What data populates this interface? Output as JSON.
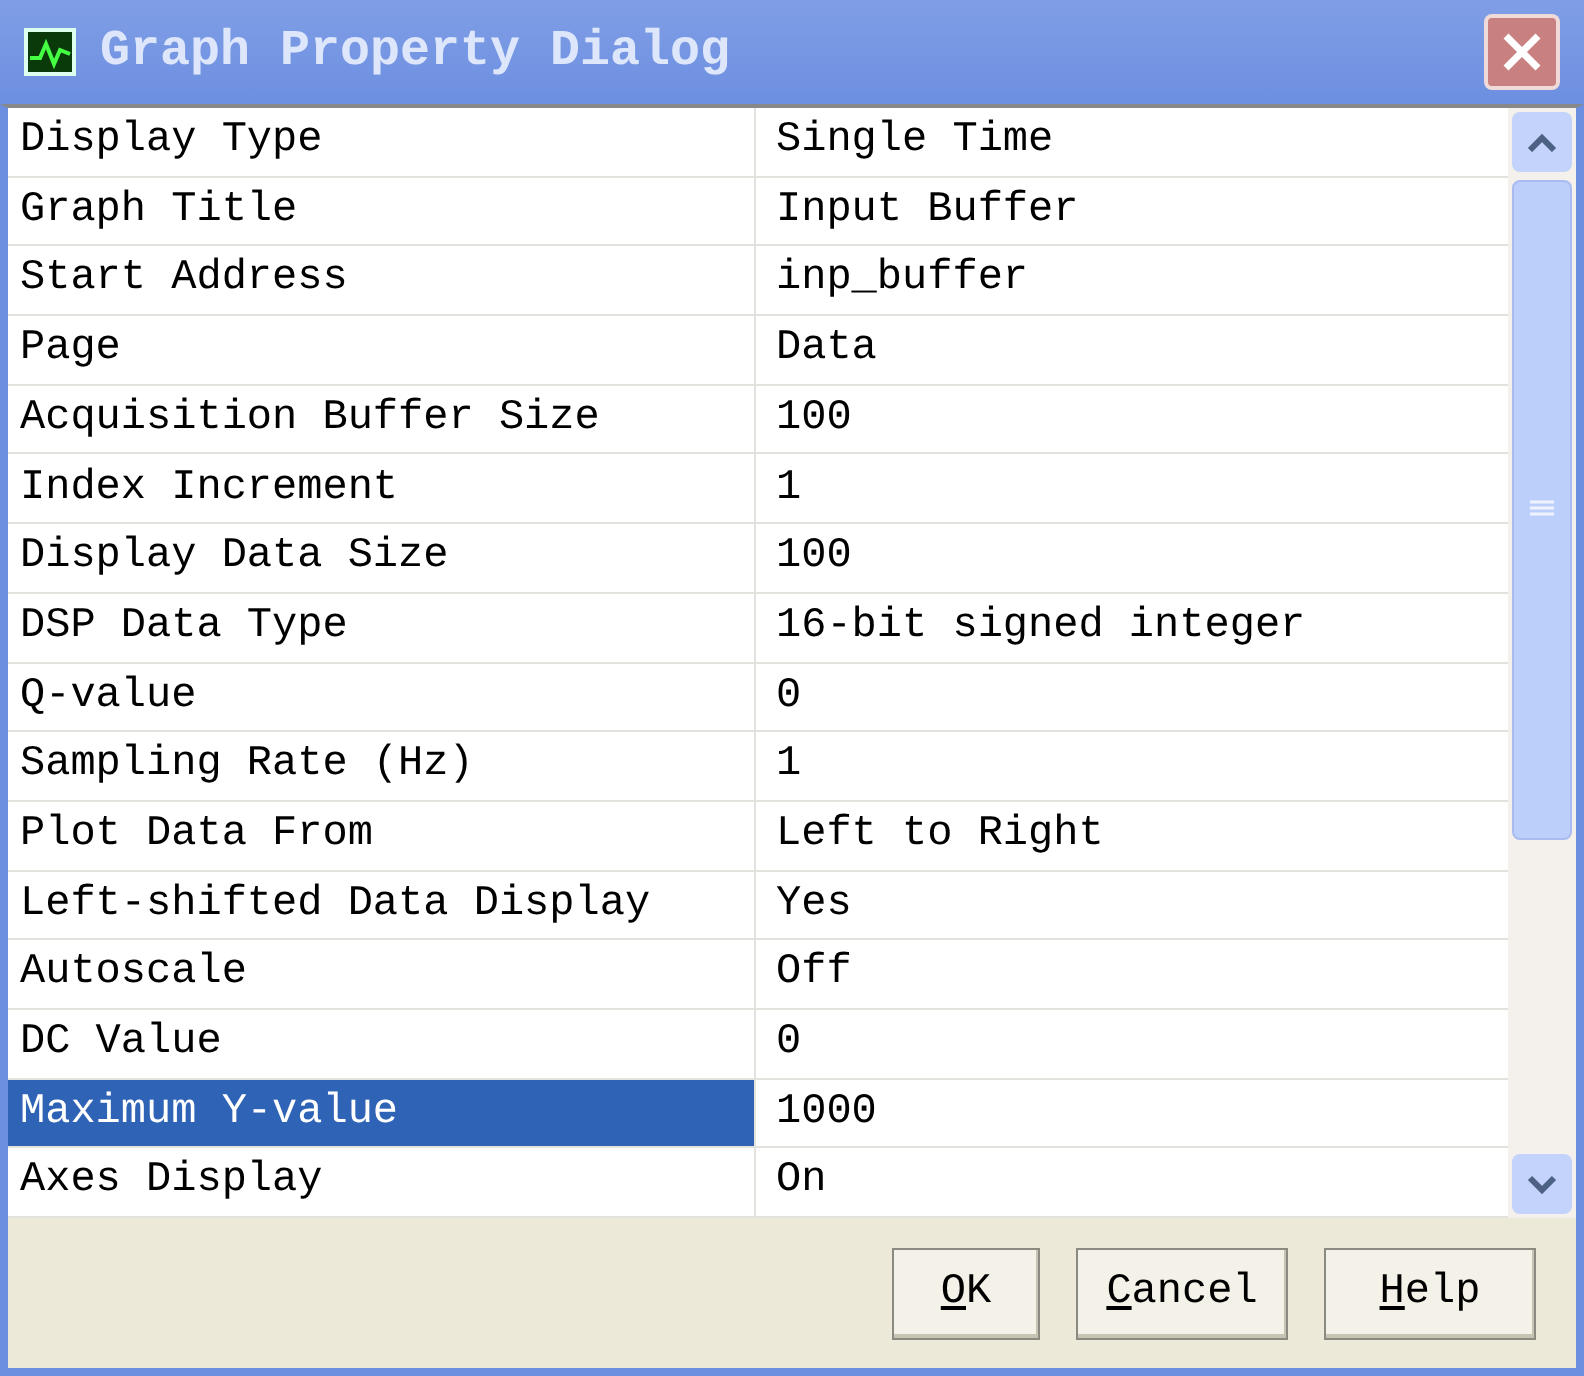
{
  "window": {
    "title": "Graph Property Dialog"
  },
  "properties": [
    {
      "name": "Display Type",
      "value": "Single Time",
      "selected": false
    },
    {
      "name": "Graph Title",
      "value": "Input Buffer",
      "selected": false
    },
    {
      "name": "Start Address",
      "value": "inp_buffer",
      "selected": false
    },
    {
      "name": "Page",
      "value": "Data",
      "selected": false
    },
    {
      "name": "Acquisition Buffer Size",
      "value": "100",
      "selected": false
    },
    {
      "name": "Index Increment",
      "value": "1",
      "selected": false
    },
    {
      "name": "Display Data Size",
      "value": "100",
      "selected": false
    },
    {
      "name": "DSP Data Type",
      "value": "16-bit signed integer",
      "selected": false
    },
    {
      "name": "Q-value",
      "value": "0",
      "selected": false
    },
    {
      "name": "Sampling Rate (Hz)",
      "value": "1",
      "selected": false
    },
    {
      "name": "Plot Data From",
      "value": "Left to Right",
      "selected": false
    },
    {
      "name": "Left-shifted Data Display",
      "value": "Yes",
      "selected": false
    },
    {
      "name": "Autoscale",
      "value": "Off",
      "selected": false
    },
    {
      "name": "DC Value",
      "value": "0",
      "selected": false
    },
    {
      "name": "Maximum Y-value",
      "value": "1000",
      "selected": true
    },
    {
      "name": "Axes Display",
      "value": "On",
      "selected": false
    }
  ],
  "buttons": [
    {
      "key": "O",
      "rest": "K"
    },
    {
      "key": "C",
      "rest": "ancel"
    },
    {
      "key": "H",
      "rest": "elp"
    }
  ]
}
